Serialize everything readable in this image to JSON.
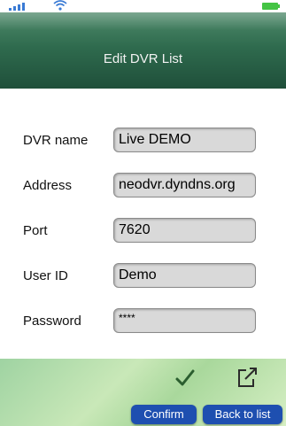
{
  "header": {
    "title": "Edit DVR List"
  },
  "form": {
    "fields": [
      {
        "label": "DVR name",
        "value": "Live DEMO"
      },
      {
        "label": "Address",
        "value": "neodvr.dyndns.org"
      },
      {
        "label": "Port",
        "value": "7620"
      },
      {
        "label": "User ID",
        "value": "Demo"
      },
      {
        "label": "Password",
        "value": "****"
      }
    ]
  },
  "footer": {
    "confirm_label": "Confirm",
    "back_label": "Back to list"
  },
  "icons": {
    "status": [
      "signal-icon",
      "wifi-icon",
      "battery-icon"
    ],
    "confirm": "checkmark-icon",
    "back": "share-arrow-icon"
  },
  "colors": {
    "nav_green": "#2f6b4e",
    "button_blue": "#1e4fb0",
    "field_bg": "#d9d9d9"
  }
}
